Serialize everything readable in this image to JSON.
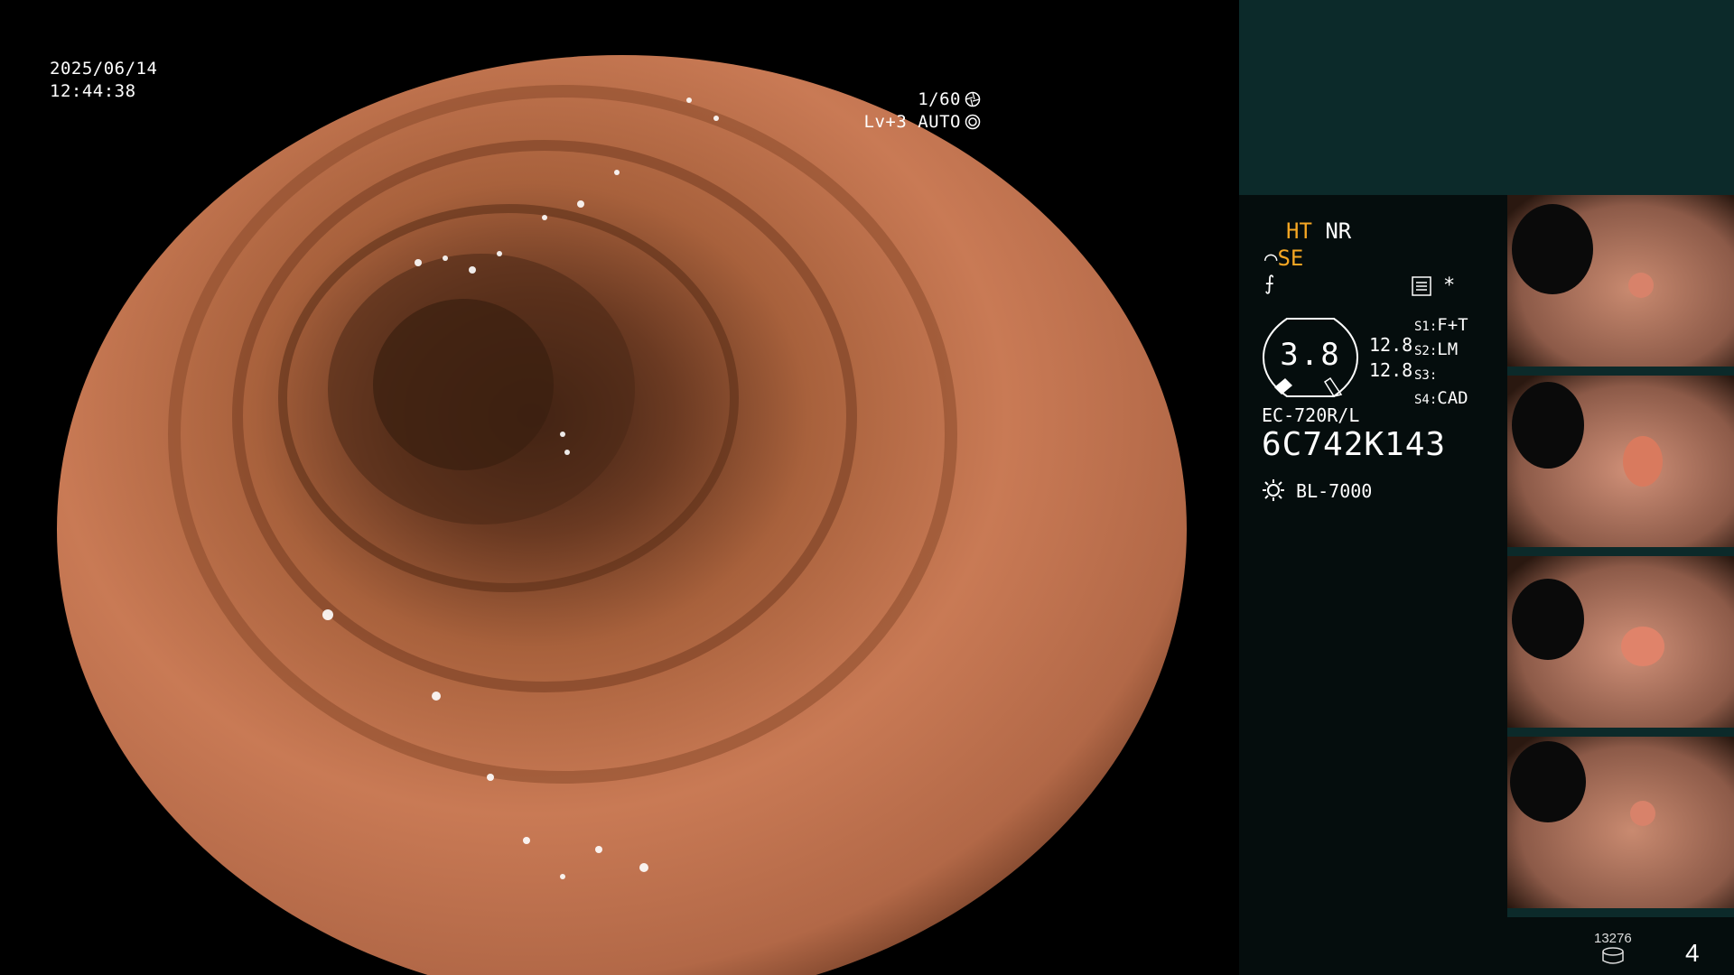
{
  "osd": {
    "date": "2025/06/14",
    "time": "12:44:38",
    "shutter": "1/60",
    "exposure": "Lv+3 AUTO"
  },
  "panel": {
    "ht": "HT",
    "nr": "NR",
    "se": "SE",
    "magnification": "3.8",
    "val_a": "12.8",
    "val_b": "12.8",
    "asterisk": "*",
    "s1": {
      "key": "S1:",
      "val": "F+T"
    },
    "s2": {
      "key": "S2:",
      "val": "LM"
    },
    "s3": {
      "key": "S3:",
      "val": ""
    },
    "s4": {
      "key": "S4:",
      "val": "CAD"
    },
    "scope_model": "EC-720R/L",
    "scope_serial": "6C742K143",
    "light_source": "BL-7000",
    "count": "13276",
    "page": "4"
  },
  "icons": {
    "shutter": "aperture-icon",
    "auto": "iris-icon",
    "settings": "menu-icon",
    "light": "lamp-icon",
    "storage": "database-icon"
  },
  "colors": {
    "accent": "#f5a623",
    "panel_top": "#0c2a2a",
    "panel_bg": "#050d0d"
  }
}
